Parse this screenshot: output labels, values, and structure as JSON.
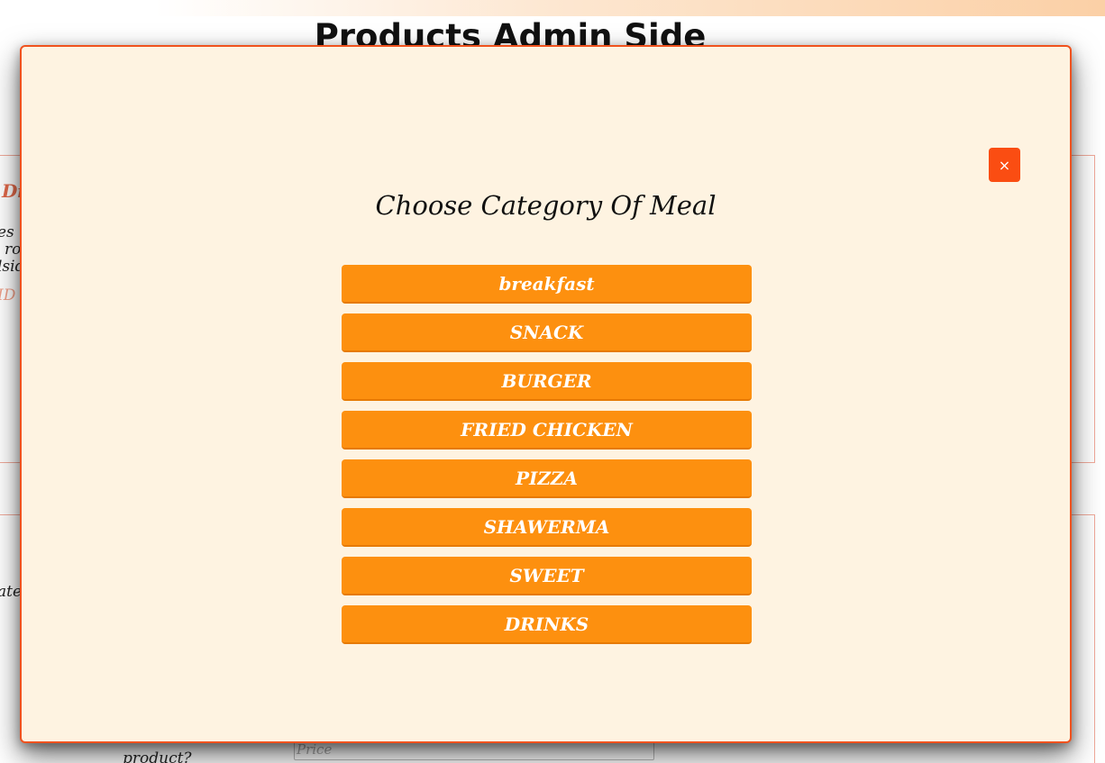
{
  "page": {
    "title": "Products Admin Side"
  },
  "background": {
    "panel1_lines": [
      "Di",
      "es",
      "ro",
      "lsid",
      "ID"
    ],
    "panel2_lines": [
      "ate"
    ],
    "partial_label": "product?",
    "price_placeholder": "Price"
  },
  "modal": {
    "title": "Choose Category Of Meal",
    "close_label": "×",
    "categories": [
      "breakfast",
      "SNACK",
      "BURGER",
      "FRIED CHICKEN",
      "PIZZA",
      "SHAWERMA",
      "SWEET",
      "DRINKS"
    ]
  },
  "colors": {
    "category_button": "#fd900f",
    "close_button": "#fa4d12",
    "modal_background": "#fef3e1",
    "modal_border": "#f0521e"
  }
}
